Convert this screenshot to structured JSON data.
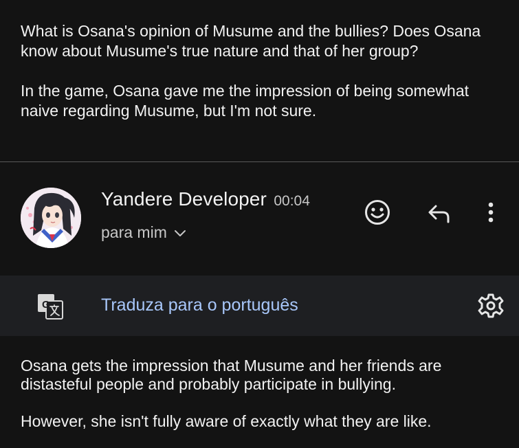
{
  "quoted_message": {
    "paragraph_1": "What is Osana's opinion of Musume and the bullies? Does Osana know about Musume's true nature and that of her group?",
    "paragraph_2": "In the game, Osana gave me the impression of being somewhat naive regarding Musume, but I'm not sure."
  },
  "reply": {
    "sender_name": "Yandere Developer",
    "time": "00:04",
    "recipient": "para mim",
    "body_paragraph_1": "Osana gets the impression that Musume and her friends are distasteful people and probably participate in bullying.",
    "body_paragraph_2": "However, she isn't fully aware of exactly what they are like."
  },
  "translate_bar": {
    "link_label": "Traduza para o português"
  },
  "icons": {
    "avatar": "anime-girl-avatar",
    "emoji": "smiley-emoji-icon",
    "reply": "reply-arrow-icon",
    "more": "more-vertical-icon",
    "recipient_expand": "chevron-down-icon",
    "translate": "translate-icon",
    "settings": "gear-icon"
  },
  "colors": {
    "background": "#131313",
    "translate_bar": "#1e1f22",
    "link": "#a8c7fa",
    "text": "#f2f2f2",
    "secondary_text": "#c7c7c7"
  }
}
